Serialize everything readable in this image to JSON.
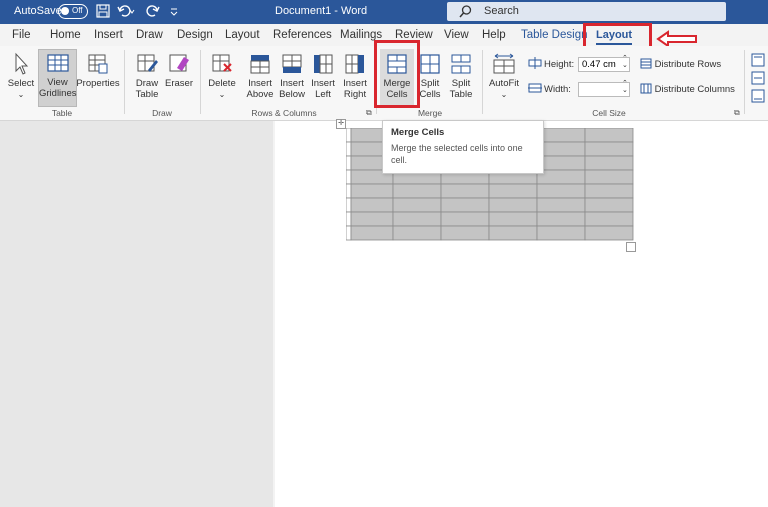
{
  "titlebar": {
    "autosave_label": "AutoSave",
    "autosave_state": "Off",
    "document_title": "Document1  -  Word",
    "search_placeholder": "Search"
  },
  "tabs": [
    "File",
    "Home",
    "Insert",
    "Draw",
    "Design",
    "Layout",
    "References",
    "Mailings",
    "Review",
    "View",
    "Help",
    "Table Design",
    "Layout"
  ],
  "ribbon": {
    "table_group": {
      "label": "Table",
      "select": "Select",
      "view_gridlines": [
        "View",
        "Gridlines"
      ],
      "properties": "Properties"
    },
    "draw_group": {
      "label": "Draw",
      "draw_table": [
        "Draw",
        "Table"
      ],
      "eraser": "Eraser"
    },
    "rows_columns_group": {
      "label": "Rows & Columns",
      "delete": "Delete",
      "insert_above": [
        "Insert",
        "Above"
      ],
      "insert_below": [
        "Insert",
        "Below"
      ],
      "insert_left": [
        "Insert",
        "Left"
      ],
      "insert_right": [
        "Insert",
        "Right"
      ]
    },
    "merge_group": {
      "label": "Merge",
      "merge_cells": [
        "Merge",
        "Cells"
      ],
      "split_cells": [
        "Split",
        "Cells"
      ],
      "split_table": [
        "Split",
        "Table"
      ]
    },
    "cell_size_group": {
      "label": "Cell Size",
      "autofit": "AutoFit",
      "height_label": "Height:",
      "height_value": "0.47 cm",
      "width_label": "Width:",
      "width_value": "",
      "distribute_rows": "Distribute Rows",
      "distribute_columns": "Distribute Columns"
    }
  },
  "tooltip": {
    "title": "Merge Cells",
    "body": "Merge the selected cells into one cell."
  },
  "table": {
    "rows": 8,
    "cols": 6
  },
  "colors": {
    "word_blue": "#2b579a",
    "highlight_red": "#d9262e",
    "selected_cell": "#c4c4c4"
  }
}
